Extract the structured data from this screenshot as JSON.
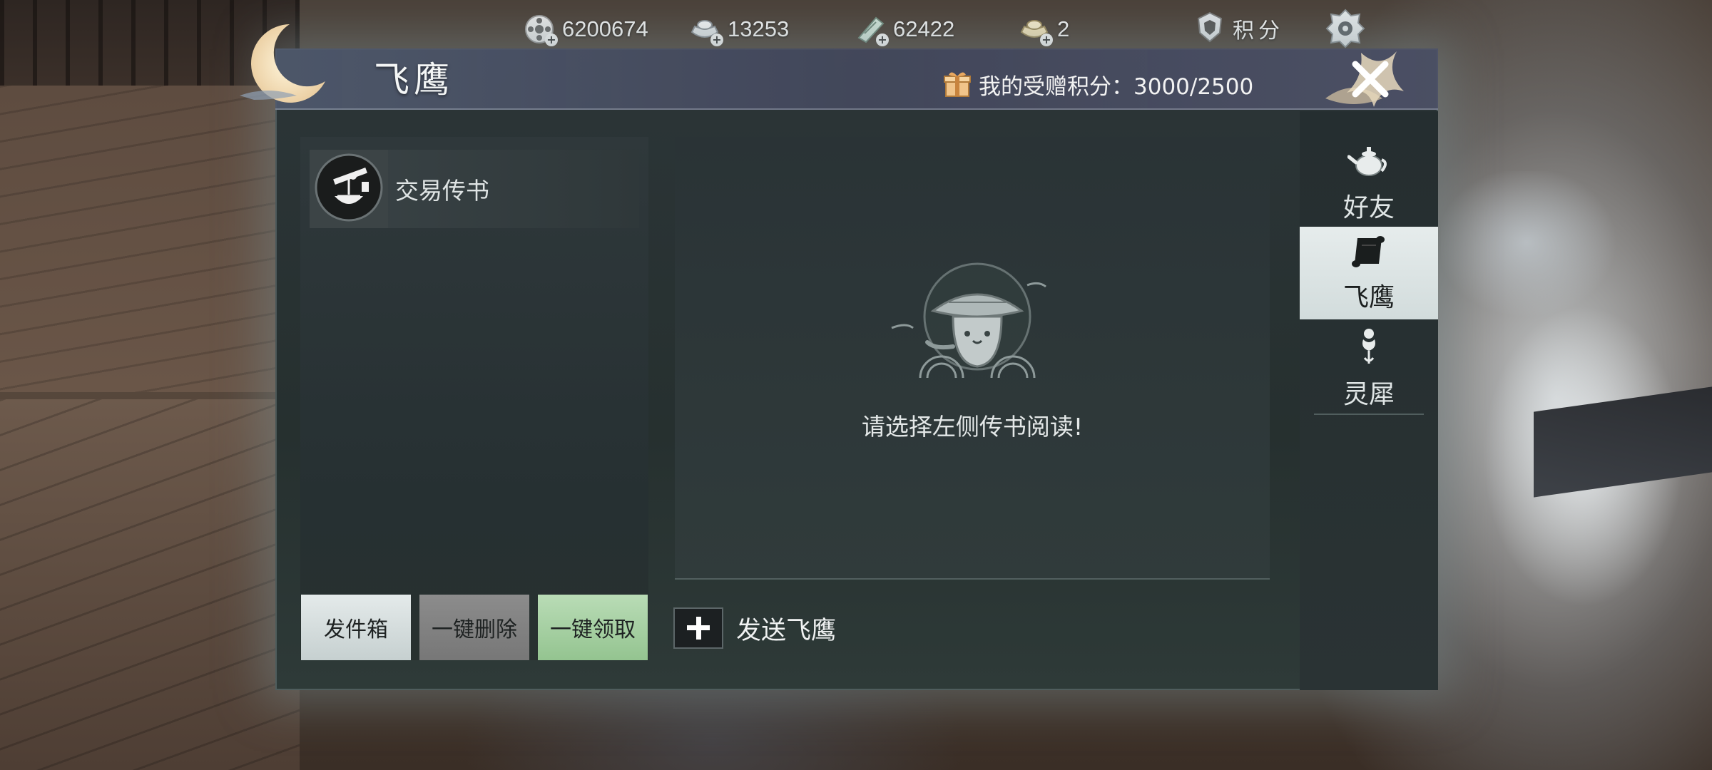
{
  "resources": [
    {
      "icon": "film-reel-coin-icon",
      "value": "6200674"
    },
    {
      "icon": "silver-ingot-icon",
      "value": "13253"
    },
    {
      "icon": "jade-ticket-icon",
      "value": "62422"
    },
    {
      "icon": "gold-ingot-icon",
      "value": "2"
    }
  ],
  "points_button": {
    "label": "积分"
  },
  "window": {
    "title": "飞鹰",
    "gift_points_label": "我的受赠积分：3000/2500"
  },
  "mail_list": {
    "items": [
      {
        "label": "交易传书",
        "icon": "trade-scale-icon"
      }
    ]
  },
  "buttons": {
    "outbox": "发件箱",
    "delete_all": "一键删除",
    "claim_all": "一键领取"
  },
  "reader": {
    "empty_hint": "请选择左侧传书阅读!"
  },
  "send": {
    "label": "发送飞鹰"
  },
  "tabs": [
    {
      "label": "好友",
      "icon": "teapot-icon",
      "active": false
    },
    {
      "label": "飞鹰",
      "icon": "scroll-icon",
      "active": true
    },
    {
      "label": "灵犀",
      "icon": "charm-icon",
      "active": false
    }
  ]
}
